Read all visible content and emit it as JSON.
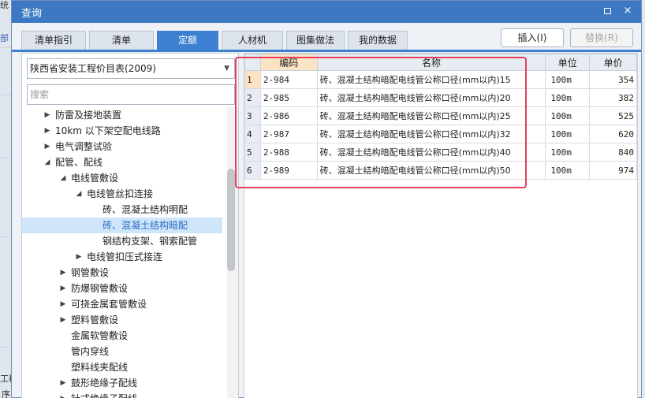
{
  "background": {
    "left_texts": [
      "部",
      "工程",
      "序"
    ],
    "top_text": "统"
  },
  "dialog": {
    "title": "查询",
    "max_icon": "maximize-icon",
    "close_icon": "close-icon",
    "close_glyph": "×"
  },
  "tabs": [
    {
      "label": "清单指引"
    },
    {
      "label": "清单"
    },
    {
      "label": "定额"
    },
    {
      "label": "人材机"
    },
    {
      "label": "图集做法"
    },
    {
      "label": "我的数据"
    }
  ],
  "actions": {
    "insert_label": "插入(I)",
    "replace_label": "替换(R)"
  },
  "left": {
    "selected_library": "陕西省安装工程价目表(2009)",
    "search_placeholder": "搜索",
    "tree": [
      {
        "label": "防雷及接地装置",
        "toggle": "▶"
      },
      {
        "label": "10km 以下架空配电线路",
        "toggle": "▶"
      },
      {
        "label": "电气调整试验",
        "toggle": "▶"
      },
      {
        "label": "配管、配线",
        "toggle": "◢"
      },
      {
        "label": "电线管敷设",
        "toggle": "◢"
      },
      {
        "label": "电线管丝扣连接",
        "toggle": "◢"
      },
      {
        "label": "砖、混凝土结构明配",
        "toggle": ""
      },
      {
        "label": "砖、混凝土结构暗配",
        "toggle": ""
      },
      {
        "label": "钢结构支架、钢索配管",
        "toggle": ""
      },
      {
        "label": "电线管扣压式接连",
        "toggle": "▶"
      },
      {
        "label": "钢管敷设",
        "toggle": "▶"
      },
      {
        "label": "防爆钢管敷设",
        "toggle": "▶"
      },
      {
        "label": "可挠金属套管敷设",
        "toggle": "▶"
      },
      {
        "label": "塑料管敷设",
        "toggle": "▶"
      },
      {
        "label": "金属软管敷设",
        "toggle": ""
      },
      {
        "label": "管内穿线",
        "toggle": ""
      },
      {
        "label": "塑料线夹配线",
        "toggle": ""
      },
      {
        "label": "鼓形绝缘子配线",
        "toggle": "▶"
      },
      {
        "label": "针式绝缘子配线",
        "toggle": "▶"
      }
    ]
  },
  "grid": {
    "headers": {
      "code": "编码",
      "name": "名称",
      "unit": "单位",
      "price": "单价"
    },
    "rows": [
      {
        "n": "1",
        "code": "2-984",
        "name": "砖、混凝土结构暗配电线管公称口径(mm以内)15",
        "unit": "100m",
        "price": "354"
      },
      {
        "n": "2",
        "code": "2-985",
        "name": "砖、混凝土结构暗配电线管公称口径(mm以内)20",
        "unit": "100m",
        "price": "382"
      },
      {
        "n": "3",
        "code": "2-986",
        "name": "砖、混凝土结构暗配电线管公称口径(mm以内)25",
        "unit": "100m",
        "price": "525"
      },
      {
        "n": "4",
        "code": "2-987",
        "name": "砖、混凝土结构暗配电线管公称口径(mm以内)32",
        "unit": "100m",
        "price": "620"
      },
      {
        "n": "5",
        "code": "2-988",
        "name": "砖、混凝土结构暗配电线管公称口径(mm以内)40",
        "unit": "100m",
        "price": "840"
      },
      {
        "n": "6",
        "code": "2-989",
        "name": "砖、混凝土结构暗配电线管公称口径(mm以内)50",
        "unit": "100m",
        "price": "974"
      }
    ]
  },
  "colors": {
    "titlebar": "#3d78c2",
    "active_tab": "#3d7fd0",
    "highlight_box": "#e6405a",
    "selected_tree_item": "#cfe5fa"
  }
}
